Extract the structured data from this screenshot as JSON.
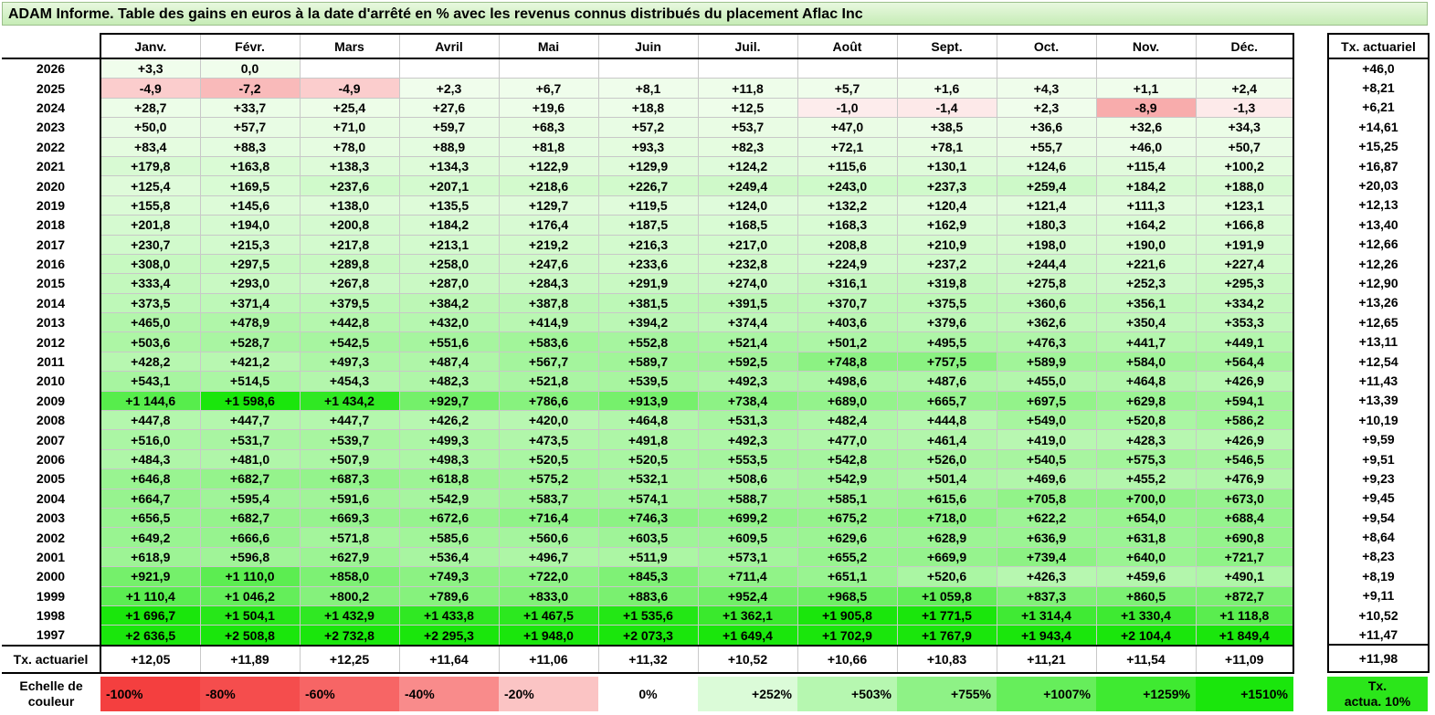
{
  "title": "ADAM Informe. Table des gains en euros à la date d'arrêté en % avec les revenus connus distribués du placement Aflac Inc",
  "months": [
    "Janv.",
    "Févr.",
    "Mars",
    "Avril",
    "Mai",
    "Juin",
    "Juil.",
    "Août",
    "Sept.",
    "Oct.",
    "Nov.",
    "Déc."
  ],
  "actuarial_header": "Tx. actuariel",
  "rows": [
    {
      "year": "2026",
      "values": [
        "+3,3",
        "0,0",
        "",
        "",
        "",
        "",
        "",
        "",
        "",
        "",
        "",
        ""
      ],
      "actuarial": "+46,0"
    },
    {
      "year": "2025",
      "values": [
        "-4,9",
        "-7,2",
        "-4,9",
        "+2,3",
        "+6,7",
        "+8,1",
        "+11,8",
        "+5,7",
        "+1,6",
        "+4,3",
        "+1,1",
        "+2,4"
      ],
      "actuarial": "+8,21"
    },
    {
      "year": "2024",
      "values": [
        "+28,7",
        "+33,7",
        "+25,4",
        "+27,6",
        "+19,6",
        "+18,8",
        "+12,5",
        "-1,0",
        "-1,4",
        "+2,3",
        "-8,9",
        "-1,3"
      ],
      "actuarial": "+6,21"
    },
    {
      "year": "2023",
      "values": [
        "+50,0",
        "+57,7",
        "+71,0",
        "+59,7",
        "+68,3",
        "+57,2",
        "+53,7",
        "+47,0",
        "+38,5",
        "+36,6",
        "+32,6",
        "+34,3"
      ],
      "actuarial": "+14,61"
    },
    {
      "year": "2022",
      "values": [
        "+83,4",
        "+88,3",
        "+78,0",
        "+88,9",
        "+81,8",
        "+93,3",
        "+82,3",
        "+72,1",
        "+78,1",
        "+55,7",
        "+46,0",
        "+50,7"
      ],
      "actuarial": "+15,25"
    },
    {
      "year": "2021",
      "values": [
        "+179,8",
        "+163,8",
        "+138,3",
        "+134,3",
        "+122,9",
        "+129,9",
        "+124,2",
        "+115,6",
        "+130,1",
        "+124,6",
        "+115,4",
        "+100,2"
      ],
      "actuarial": "+16,87"
    },
    {
      "year": "2020",
      "values": [
        "+125,4",
        "+169,5",
        "+237,6",
        "+207,1",
        "+218,6",
        "+226,7",
        "+249,4",
        "+243,0",
        "+237,3",
        "+259,4",
        "+184,2",
        "+188,0"
      ],
      "actuarial": "+20,03"
    },
    {
      "year": "2019",
      "values": [
        "+155,8",
        "+145,6",
        "+138,0",
        "+135,5",
        "+129,7",
        "+119,5",
        "+124,0",
        "+132,2",
        "+120,4",
        "+121,4",
        "+111,3",
        "+123,1"
      ],
      "actuarial": "+12,13"
    },
    {
      "year": "2018",
      "values": [
        "+201,8",
        "+194,0",
        "+200,8",
        "+184,2",
        "+176,4",
        "+187,5",
        "+168,5",
        "+168,3",
        "+162,9",
        "+180,3",
        "+164,2",
        "+166,8"
      ],
      "actuarial": "+13,40"
    },
    {
      "year": "2017",
      "values": [
        "+230,7",
        "+215,3",
        "+217,8",
        "+213,1",
        "+219,2",
        "+216,3",
        "+217,0",
        "+208,8",
        "+210,9",
        "+198,0",
        "+190,0",
        "+191,9"
      ],
      "actuarial": "+12,66"
    },
    {
      "year": "2016",
      "values": [
        "+308,0",
        "+297,5",
        "+289,8",
        "+258,0",
        "+247,6",
        "+233,6",
        "+232,8",
        "+224,9",
        "+237,2",
        "+244,4",
        "+221,6",
        "+227,4"
      ],
      "actuarial": "+12,26"
    },
    {
      "year": "2015",
      "values": [
        "+333,4",
        "+293,0",
        "+267,8",
        "+287,0",
        "+284,3",
        "+291,9",
        "+274,0",
        "+316,1",
        "+319,8",
        "+275,8",
        "+252,3",
        "+295,3"
      ],
      "actuarial": "+12,90"
    },
    {
      "year": "2014",
      "values": [
        "+373,5",
        "+371,4",
        "+379,5",
        "+384,2",
        "+387,8",
        "+381,5",
        "+391,5",
        "+370,7",
        "+375,5",
        "+360,6",
        "+356,1",
        "+334,2"
      ],
      "actuarial": "+13,26"
    },
    {
      "year": "2013",
      "values": [
        "+465,0",
        "+478,9",
        "+442,8",
        "+432,0",
        "+414,9",
        "+394,2",
        "+374,4",
        "+403,6",
        "+379,6",
        "+362,6",
        "+350,4",
        "+353,3"
      ],
      "actuarial": "+12,65"
    },
    {
      "year": "2012",
      "values": [
        "+503,6",
        "+528,7",
        "+542,5",
        "+551,6",
        "+583,6",
        "+552,8",
        "+521,4",
        "+501,2",
        "+495,5",
        "+476,3",
        "+441,7",
        "+449,1"
      ],
      "actuarial": "+13,11"
    },
    {
      "year": "2011",
      "values": [
        "+428,2",
        "+421,2",
        "+497,3",
        "+487,4",
        "+567,7",
        "+589,7",
        "+592,5",
        "+748,8",
        "+757,5",
        "+589,9",
        "+584,0",
        "+564,4"
      ],
      "actuarial": "+12,54"
    },
    {
      "year": "2010",
      "values": [
        "+543,1",
        "+514,5",
        "+454,3",
        "+482,3",
        "+521,8",
        "+539,5",
        "+492,3",
        "+498,6",
        "+487,6",
        "+455,0",
        "+464,8",
        "+426,9"
      ],
      "actuarial": "+11,43"
    },
    {
      "year": "2009",
      "values": [
        "+1 144,6",
        "+1 598,6",
        "+1 434,2",
        "+929,7",
        "+786,6",
        "+913,9",
        "+738,4",
        "+689,0",
        "+665,7",
        "+697,5",
        "+629,8",
        "+594,1"
      ],
      "actuarial": "+13,39"
    },
    {
      "year": "2008",
      "values": [
        "+447,8",
        "+447,7",
        "+447,7",
        "+426,2",
        "+420,0",
        "+464,8",
        "+531,3",
        "+482,4",
        "+444,8",
        "+549,0",
        "+520,8",
        "+586,2"
      ],
      "actuarial": "+10,19"
    },
    {
      "year": "2007",
      "values": [
        "+516,0",
        "+531,7",
        "+539,7",
        "+499,3",
        "+473,5",
        "+491,8",
        "+492,3",
        "+477,0",
        "+461,4",
        "+419,0",
        "+428,3",
        "+426,9"
      ],
      "actuarial": "+9,59"
    },
    {
      "year": "2006",
      "values": [
        "+484,3",
        "+481,0",
        "+507,9",
        "+498,3",
        "+520,5",
        "+520,5",
        "+553,5",
        "+542,8",
        "+526,0",
        "+540,5",
        "+575,3",
        "+546,5"
      ],
      "actuarial": "+9,51"
    },
    {
      "year": "2005",
      "values": [
        "+646,8",
        "+682,7",
        "+687,3",
        "+618,8",
        "+575,2",
        "+532,1",
        "+508,6",
        "+542,9",
        "+501,4",
        "+469,6",
        "+455,2",
        "+476,9"
      ],
      "actuarial": "+9,23"
    },
    {
      "year": "2004",
      "values": [
        "+664,7",
        "+595,4",
        "+591,6",
        "+542,9",
        "+583,7",
        "+574,1",
        "+588,7",
        "+585,1",
        "+615,6",
        "+705,8",
        "+700,0",
        "+673,0"
      ],
      "actuarial": "+9,45"
    },
    {
      "year": "2003",
      "values": [
        "+656,5",
        "+682,7",
        "+669,3",
        "+672,6",
        "+716,4",
        "+746,3",
        "+699,2",
        "+675,2",
        "+718,0",
        "+622,2",
        "+654,0",
        "+688,4"
      ],
      "actuarial": "+9,54"
    },
    {
      "year": "2002",
      "values": [
        "+649,2",
        "+666,6",
        "+571,8",
        "+585,6",
        "+560,6",
        "+603,5",
        "+609,5",
        "+629,6",
        "+628,9",
        "+636,9",
        "+631,8",
        "+690,8"
      ],
      "actuarial": "+8,64"
    },
    {
      "year": "2001",
      "values": [
        "+618,9",
        "+596,8",
        "+627,9",
        "+536,4",
        "+496,7",
        "+511,9",
        "+573,1",
        "+655,2",
        "+669,9",
        "+739,4",
        "+640,0",
        "+721,7"
      ],
      "actuarial": "+8,23"
    },
    {
      "year": "2000",
      "values": [
        "+921,9",
        "+1 110,0",
        "+858,0",
        "+749,3",
        "+722,0",
        "+845,3",
        "+711,4",
        "+651,1",
        "+520,6",
        "+426,3",
        "+459,6",
        "+490,1"
      ],
      "actuarial": "+8,19"
    },
    {
      "year": "1999",
      "values": [
        "+1 110,4",
        "+1 046,2",
        "+800,2",
        "+789,6",
        "+833,0",
        "+883,6",
        "+952,4",
        "+968,5",
        "+1 059,8",
        "+837,3",
        "+860,5",
        "+872,7"
      ],
      "actuarial": "+9,11"
    },
    {
      "year": "1998",
      "values": [
        "+1 696,7",
        "+1 504,1",
        "+1 432,9",
        "+1 433,8",
        "+1 467,5",
        "+1 535,6",
        "+1 362,1",
        "+1 905,8",
        "+1 771,5",
        "+1 314,4",
        "+1 330,4",
        "+1 118,8"
      ],
      "actuarial": "+10,52"
    },
    {
      "year": "1997",
      "values": [
        "+2 636,5",
        "+2 508,8",
        "+2 732,8",
        "+2 295,3",
        "+1 948,0",
        "+2 073,3",
        "+1 649,4",
        "+1 702,9",
        "+1 767,9",
        "+1 943,4",
        "+2 104,4",
        "+1 849,4"
      ],
      "actuarial": "+11,47"
    }
  ],
  "footer": {
    "label": "Tx. actuariel",
    "values": [
      "+12,05",
      "+11,89",
      "+12,25",
      "+11,64",
      "+11,06",
      "+11,32",
      "+10,52",
      "+10,66",
      "+10,83",
      "+11,21",
      "+11,54",
      "+11,09"
    ],
    "actuarial": "+11,98"
  },
  "legend": {
    "label_line1": "Echelle de",
    "label_line2": "couleur",
    "items": [
      {
        "label": "-100%",
        "color": "#f43f3f",
        "align": "left"
      },
      {
        "label": "-80%",
        "color": "#f54d4d",
        "align": "left"
      },
      {
        "label": "-60%",
        "color": "#f76565",
        "align": "left"
      },
      {
        "label": "-40%",
        "color": "#f98b8b",
        "align": "left"
      },
      {
        "label": "-20%",
        "color": "#fbc4c4",
        "align": "left"
      },
      {
        "label": "0%",
        "color": "#ffffff",
        "align": "center"
      },
      {
        "label": "+252%",
        "color": "#dbfbd8",
        "align": "right"
      },
      {
        "label": "+503%",
        "color": "#b6f7b0",
        "align": "right"
      },
      {
        "label": "+755%",
        "color": "#8ef286",
        "align": "right"
      },
      {
        "label": "+1007%",
        "color": "#66ee5b",
        "align": "right"
      },
      {
        "label": "+1259%",
        "color": "#3fea31",
        "align": "right"
      },
      {
        "label": "+1510%",
        "color": "#1ae60c",
        "align": "right"
      }
    ],
    "right_line1": "Tx.",
    "right_line2": "actua. 10%",
    "right_color": "#2be61a"
  }
}
